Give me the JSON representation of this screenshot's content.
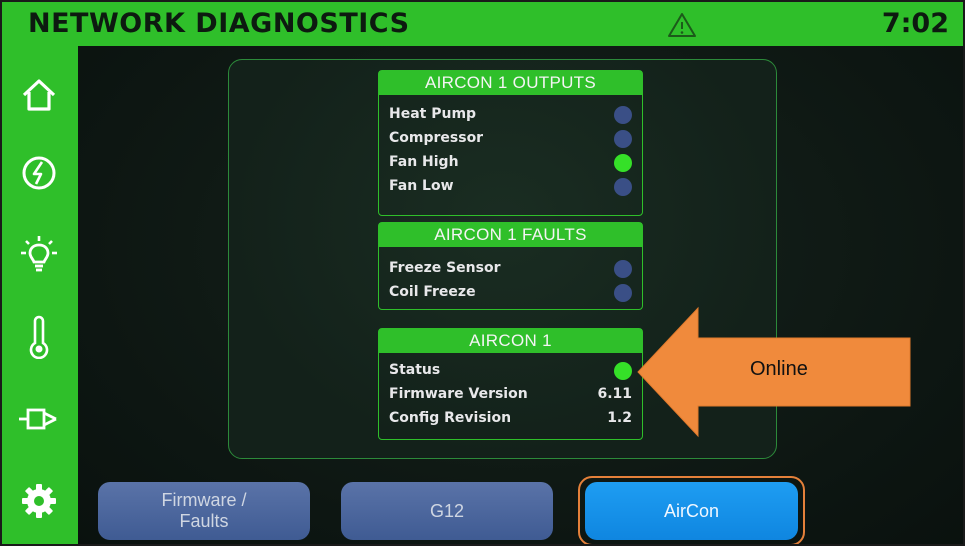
{
  "header": {
    "title": "NETWORK DIAGNOSTICS",
    "time": "7:02"
  },
  "sidebar": {
    "items": [
      {
        "icon": "home-icon"
      },
      {
        "icon": "power-icon"
      },
      {
        "icon": "light-bulb-icon"
      },
      {
        "icon": "thermometer-icon"
      },
      {
        "icon": "plug-icon"
      },
      {
        "icon": "gear-icon"
      }
    ]
  },
  "outputs": {
    "title": "AIRCON 1 OUTPUTS",
    "rows": [
      {
        "label": "Heat Pump",
        "on": false
      },
      {
        "label": "Compressor",
        "on": false
      },
      {
        "label": "Fan High",
        "on": true
      },
      {
        "label": "Fan Low",
        "on": false
      }
    ]
  },
  "faults": {
    "title": "AIRCON 1 FAULTS",
    "rows": [
      {
        "label": "Freeze Sensor",
        "on": false
      },
      {
        "label": "Coil Freeze",
        "on": false
      }
    ]
  },
  "aircon": {
    "title": "AIRCON 1",
    "status_label": "Status",
    "status_on": true,
    "firmware_label": "Firmware Version",
    "firmware_value": "6.11",
    "config_label": "Config Revision",
    "config_value": "1.2"
  },
  "tabs": [
    {
      "label": "Firmware /\nFaults",
      "active": false
    },
    {
      "label": "G12",
      "active": false
    },
    {
      "label": "AirCon",
      "active": true
    }
  ],
  "callout": {
    "text": "Online"
  },
  "colors": {
    "accent_green": "#2fbf2a",
    "status_on": "#35e028",
    "status_off": "#3a4f86",
    "tab_active": "#1e9df2",
    "tab_inactive": "#4a6499",
    "callout": "#f08a3c"
  }
}
